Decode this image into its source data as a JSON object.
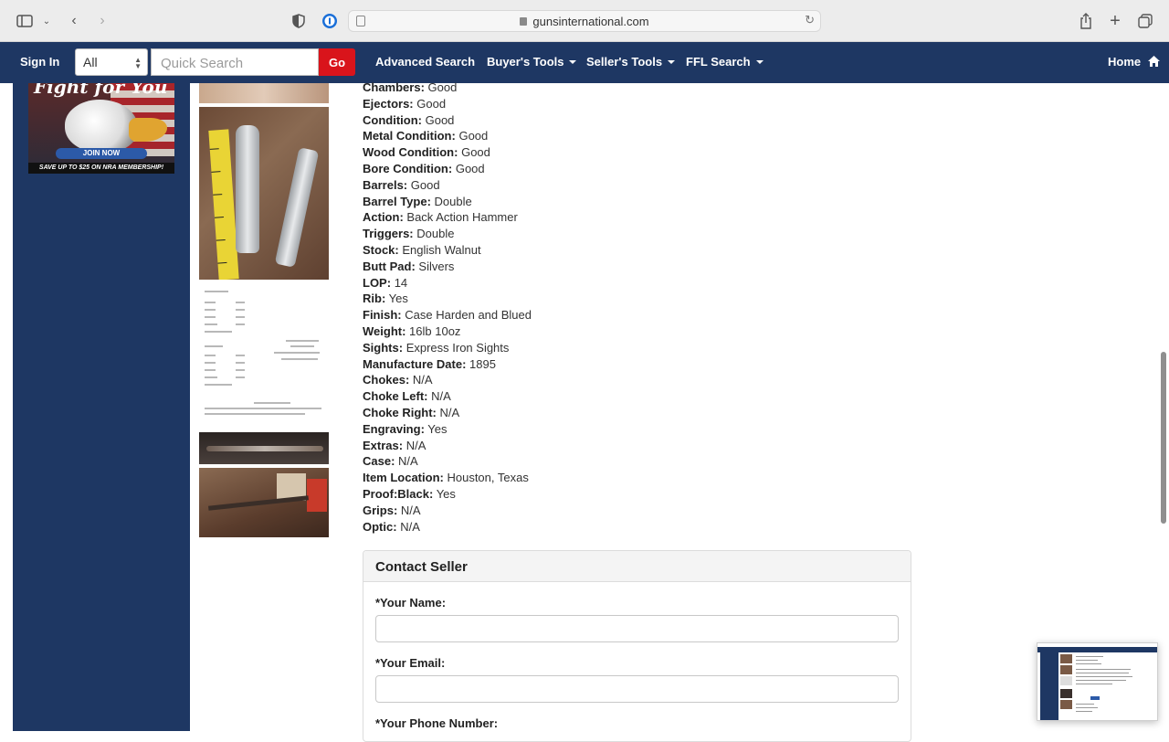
{
  "browser": {
    "url": "gunsinternational.com"
  },
  "site_nav": {
    "sign_in": "Sign In",
    "search_category": "All",
    "search_placeholder": "Quick Search",
    "go_label": "Go",
    "advanced_search": "Advanced Search",
    "buyers_tools": "Buyer's Tools",
    "sellers_tools": "Seller's Tools",
    "ffl_search": "FFL Search",
    "home": "Home"
  },
  "ad": {
    "headline": "Fight for You",
    "join_button": "JOIN NOW",
    "tagline": "SAVE UP TO $25 ON NRA MEMBERSHIP!"
  },
  "specs": [
    {
      "label": "Chambers:",
      "value": "Good"
    },
    {
      "label": "Ejectors:",
      "value": "Good"
    },
    {
      "label": "Condition:",
      "value": "Good"
    },
    {
      "label": "Metal Condition:",
      "value": "Good"
    },
    {
      "label": "Wood Condition:",
      "value": "Good"
    },
    {
      "label": "Bore Condition:",
      "value": "Good"
    },
    {
      "label": "Barrels:",
      "value": "Good"
    },
    {
      "label": "Barrel Type:",
      "value": "Double"
    },
    {
      "label": "Action:",
      "value": "Back Action Hammer"
    },
    {
      "label": "Triggers:",
      "value": "Double"
    },
    {
      "label": "Stock:",
      "value": "English Walnut"
    },
    {
      "label": "Butt Pad:",
      "value": "Silvers"
    },
    {
      "label": "LOP:",
      "value": "14"
    },
    {
      "label": "Rib:",
      "value": "Yes"
    },
    {
      "label": "Finish:",
      "value": "Case Harden and Blued"
    },
    {
      "label": "Weight:",
      "value": "16lb 10oz"
    },
    {
      "label": "Sights:",
      "value": "Express Iron Sights"
    },
    {
      "label": "Manufacture Date:",
      "value": "1895"
    },
    {
      "label": "Chokes:",
      "value": "N/A"
    },
    {
      "label": "Choke Left:",
      "value": "N/A"
    },
    {
      "label": "Choke Right:",
      "value": "N/A"
    },
    {
      "label": "Engraving:",
      "value": "Yes"
    },
    {
      "label": "Extras:",
      "value": "N/A"
    },
    {
      "label": "Case:",
      "value": "N/A"
    },
    {
      "label": "Item Location:",
      "value": "Houston, Texas"
    },
    {
      "label": "Proof:Black:",
      "value": "Yes"
    },
    {
      "label": "Grips:",
      "value": "N/A"
    },
    {
      "label": "Optic:",
      "value": "N/A"
    }
  ],
  "contact": {
    "title": "Contact Seller",
    "name_label": "*Your Name:",
    "email_label": "*Your Email:",
    "phone_label": "*Your Phone Number:"
  }
}
